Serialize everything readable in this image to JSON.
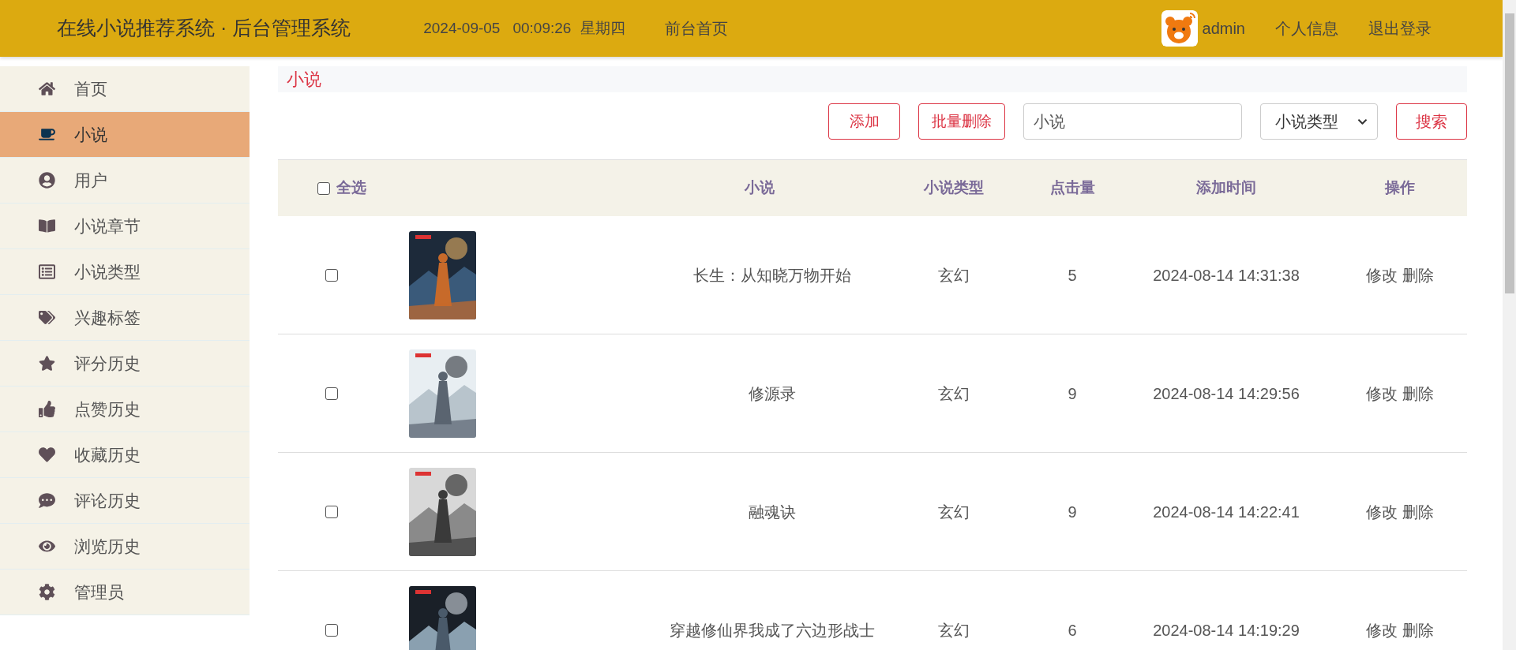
{
  "header": {
    "title": "在线小说推荐系统 · 后台管理系统",
    "date": "2024-09-05",
    "time": "00:09:26",
    "weekday": "星期四",
    "home_link": "前台首页",
    "user": "admin",
    "profile_link": "个人信息",
    "logout_link": "退出登录"
  },
  "sidebar": {
    "items": [
      {
        "label": "首页",
        "selected": false
      },
      {
        "label": "小说",
        "selected": true
      },
      {
        "label": "用户",
        "selected": false
      },
      {
        "label": "小说章节",
        "selected": false
      },
      {
        "label": "小说类型",
        "selected": false
      },
      {
        "label": "兴趣标签",
        "selected": false
      },
      {
        "label": "评分历史",
        "selected": false
      },
      {
        "label": "点赞历史",
        "selected": false
      },
      {
        "label": "收藏历史",
        "selected": false
      },
      {
        "label": "评论历史",
        "selected": false
      },
      {
        "label": "浏览历史",
        "selected": false
      },
      {
        "label": "管理员",
        "selected": false
      }
    ]
  },
  "breadcrumb": "小说",
  "toolbar": {
    "add_button": "添加",
    "batch_delete_button": "批量删除",
    "search_value": "小说",
    "type_select": "小说类型",
    "search_button": "搜索"
  },
  "table": {
    "select_all": {
      "label": "全选",
      "checked": false
    },
    "columns": [
      "小说",
      "小说类型",
      "点击量",
      "添加时间",
      "操作"
    ],
    "rows": [
      {
        "checked": false,
        "title": "长生：从知晓万物开始",
        "type": "玄幻",
        "clicks": "5",
        "added": "2024-08-14 14:31:38",
        "edit": "修改",
        "delete": "删除"
      },
      {
        "checked": false,
        "title": "修源录",
        "type": "玄幻",
        "clicks": "9",
        "added": "2024-08-14 14:29:56",
        "edit": "修改",
        "delete": "删除"
      },
      {
        "checked": false,
        "title": "融魂诀",
        "type": "玄幻",
        "clicks": "9",
        "added": "2024-08-14 14:22:41",
        "edit": "修改",
        "delete": "删除"
      },
      {
        "checked": false,
        "title": "穿越修仙界我成了六边形战士",
        "type": "玄幻",
        "clicks": "6",
        "added": "2024-08-14 14:19:29",
        "edit": "修改",
        "delete": "删除"
      }
    ]
  }
}
